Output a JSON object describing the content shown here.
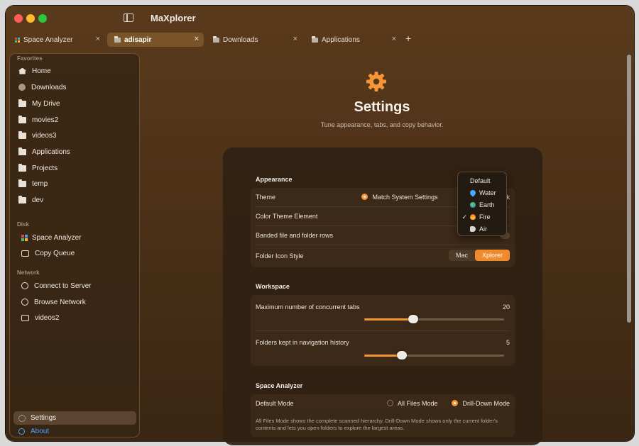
{
  "window": {
    "title": "MaXplorer"
  },
  "tabs": [
    {
      "label": "Space Analyzer",
      "close": "×"
    },
    {
      "label": "adisapir",
      "close": "×"
    },
    {
      "label": "Downloads",
      "close": "×"
    },
    {
      "label": "Applications",
      "close": "×"
    }
  ],
  "tab_add": "+",
  "sidebar": {
    "favorites_title": "Favorites",
    "favorites": [
      "Home",
      "Downloads",
      "My Drive",
      "movies2",
      "videos3",
      "Applications",
      "Projects",
      "temp",
      "dev"
    ],
    "disk_title": "Disk",
    "disk": [
      "Space Analyzer",
      "Copy Queue"
    ],
    "network_title": "Network",
    "network": [
      "Connect to Server",
      "Browse Network",
      "videos2"
    ],
    "settings_label": "Settings",
    "about_label": "About"
  },
  "settings": {
    "title": "Settings",
    "subtitle": "Tune appearance, tabs, and copy behavior.",
    "appearance": {
      "title": "Appearance",
      "theme_label": "Theme",
      "theme_option": "Match System Settings",
      "theme_partial": "k",
      "color_theme_label": "Color Theme Element",
      "banded_label": "Banded file and folder rows",
      "folder_icon_label": "Folder Icon Style",
      "folder_icon_options": [
        "Mac",
        "Xplorer"
      ],
      "folder_icon_selected": "Xplorer"
    },
    "workspace": {
      "title": "Workspace",
      "max_tabs_label": "Maximum number of concurrent tabs",
      "max_tabs_value": "20",
      "max_tabs_fraction": 0.35,
      "history_label": "Folders kept in navigation history",
      "history_value": "5",
      "history_fraction": 0.27
    },
    "space_analyzer": {
      "title": "Space Analyzer",
      "default_mode_label": "Default Mode",
      "mode_all": "All Files Mode",
      "mode_drill": "Drill-Down Mode",
      "mode_selected": "Drill-Down Mode",
      "help_text": "All Files Mode shows the complete scanned hierarchy. Drill-Down Mode shows only the current folder's contents and lets you open folders to explore the largest areas."
    }
  },
  "color_theme_menu": {
    "items": [
      "Default",
      "Water",
      "Earth",
      "Fire",
      "Air"
    ],
    "selected": "Fire",
    "check": "✓"
  },
  "colors": {
    "accent": "#f49537",
    "link": "#47a3ff"
  }
}
